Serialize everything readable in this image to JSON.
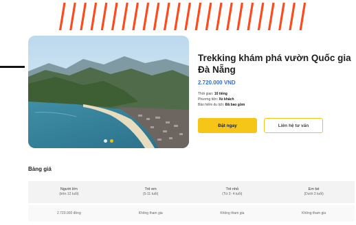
{
  "tour": {
    "title": "Trekking khám phá vườn Quốc gia Đà Nẵng",
    "price": "2.720.000 VND",
    "details": [
      {
        "label": "Thời gian: ",
        "value": "10 tiếng"
      },
      {
        "label": "Phương tiện: ",
        "value": "Xe khách"
      },
      {
        "label": "Bảo hiểm du lịch: ",
        "value": "Đã bao gồm"
      }
    ],
    "book_label": "Đặt ngay",
    "contact_label": "Liên hệ tư vấn"
  },
  "gallery": {
    "dots": 2,
    "active_dot": 2
  },
  "pricing": {
    "title": "Bảng giá",
    "columns": [
      {
        "name": "Người lớn",
        "note": "(trên 12 tuổi)",
        "value": "2.720.000 đồng"
      },
      {
        "name": "Trẻ em",
        "note": "(5-11 tuổi)",
        "value": "Không tham gia"
      },
      {
        "name": "Trẻ nhỏ",
        "note": "(Từ 2- 4 tuổi)",
        "value": "Không tham gia"
      },
      {
        "name": "Em bé",
        "note": "(Dưới 2 tuổi)",
        "value": "Không tham gia"
      }
    ]
  },
  "colors": {
    "accent": "#f5c518",
    "price": "#2f6fd6",
    "stripes": "#ff4a1c"
  }
}
